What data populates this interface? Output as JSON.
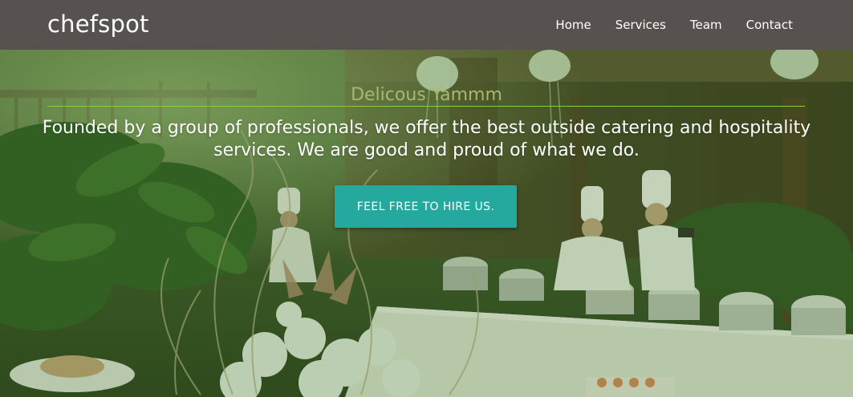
{
  "navbar": {
    "brand": "chefspot",
    "links": [
      {
        "label": "Home"
      },
      {
        "label": "Services"
      },
      {
        "label": "Team"
      },
      {
        "label": "Contact"
      }
    ],
    "background": "#57524f"
  },
  "hero": {
    "tagline": "Delicous Yammm",
    "lead": "Founded by a group of professionals, we offer the best outside catering and hospitality services. We are good and proud of what we do.",
    "cta_label": "FEEL FREE TO HIRE US.",
    "cta_color": "#25a99e",
    "rule_color": "#8bd12e"
  }
}
